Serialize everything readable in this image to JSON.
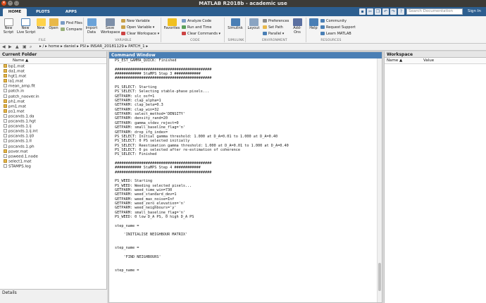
{
  "window": {
    "title": "MATLAB R2018b - academic use"
  },
  "tabs": [
    "HOME",
    "PLOTS",
    "APPS"
  ],
  "search": {
    "placeholder": "Search Documentation"
  },
  "signin": "Sign In",
  "ribbon": {
    "file": {
      "new_script": "New\nScript",
      "new_live_script": "New\nLive Script",
      "new": "New",
      "open": "Open",
      "find_files": "Find Files",
      "compare": "Compare",
      "label": "FILE"
    },
    "variable": {
      "import_data": "Import\nData",
      "save_workspace": "Save\nWorkspace",
      "new_variable": "New Variable",
      "open_variable": "Open Variable",
      "clear_workspace": "Clear Workspace",
      "label": "VARIABLE"
    },
    "code": {
      "favorites": "Favorites",
      "analyze_code": "Analyze Code",
      "run_and_time": "Run and Time",
      "clear_commands": "Clear Commands",
      "label": "CODE"
    },
    "simulink": {
      "simulink": "Simulink",
      "label": "SIMULINK"
    },
    "environment": {
      "layout": "Layout",
      "preferences": "Preferences",
      "set_path": "Set Path",
      "parallel": "Parallel",
      "addons": "Add-Ons",
      "label": "ENVIRONMENT"
    },
    "resources": {
      "help": "Help",
      "community": "Community",
      "request_support": "Request Support",
      "learn_matlab": "Learn MATLAB",
      "label": "RESOURCES"
    }
  },
  "path": {
    "crumbs": "▸  /  ▸  home  ▸  daniel  ▸  PSI  ▸  INSAR_20181129  ▸  PATCH_1  ▸"
  },
  "current_folder": {
    "title": "Current Folder",
    "column": "Name ▲",
    "files": [
      {
        "name": "bp1.mat",
        "type": "mat"
      },
      {
        "name": "da1.mat",
        "type": "mat"
      },
      {
        "name": "hgt1.mat",
        "type": "mat"
      },
      {
        "name": "la1.mat",
        "type": "mat"
      },
      {
        "name": "mean_amp.flt",
        "type": "txt"
      },
      {
        "name": "patch.in",
        "type": "txt"
      },
      {
        "name": "patch_noover.in",
        "type": "txt"
      },
      {
        "name": "ph1.mat",
        "type": "mat"
      },
      {
        "name": "pm1.mat",
        "type": "mat"
      },
      {
        "name": "ps1.mat",
        "type": "mat"
      },
      {
        "name": "pscands.1.da",
        "type": "txt"
      },
      {
        "name": "pscands.1.hgt",
        "type": "txt"
      },
      {
        "name": "pscands.1.ij",
        "type": "txt"
      },
      {
        "name": "pscands.1.ij.int",
        "type": "txt"
      },
      {
        "name": "pscands.1.ij0",
        "type": "txt"
      },
      {
        "name": "pscands.1.II",
        "type": "txt"
      },
      {
        "name": "pscands.1.ph",
        "type": "txt"
      },
      {
        "name": "psver.mat",
        "type": "mat"
      },
      {
        "name": "psweed.1.node",
        "type": "txt"
      },
      {
        "name": "select1.mat",
        "type": "mat"
      },
      {
        "name": "STAMPS.log",
        "type": "txt"
      }
    ],
    "details": "Details"
  },
  "command_window": {
    "title": "Command Window",
    "lines": [
      "PS_EST_GAMMA_QUICK: Finished",
      "",
      "############################################",
      "############ StaMPS Step 3 ############",
      "############################################",
      "",
      "PS_SELECT: Starting",
      "PS_SELECT: Selecting stable-phase pixels...",
      "GETPARM: slc_osf=1",
      "GETPARM: clap_alpha=1",
      "GETPARM: clap_beta=0.3",
      "GETPARM: clap_win=32",
      "GETPARM: select_method='DENSITY'",
      "GETPARM: density_rand=20",
      "GETPARM: gamma_stdev_reject=0",
      "GETPARM: small_baseline_flag='n'",
      "GETPARM: drop_ifg_index=",
      "PS_SELECT: Initial gamma threshold: 1.000 at D_A=0.01 to 1.000 at D_A=0.40",
      "PS_SELECT: 0 PS selected initially",
      "PS_SELECT: Reestimation gamma threshold: 1.000 at D_A=0.01 to 1.000 at D_A=0.40",
      "PS_SELECT: 0 ps selected after re-estimation of coherence",
      "PS_SELECT: Finished",
      "",
      "############################################",
      "############ StaMPS Step 4 ############",
      "############################################",
      "",
      "PS_WEED: Starting",
      "PS_WEED: Weeding selected pixels...",
      "GETPARM: weed_time_win=730",
      "GETPARM: weed_standard_dev=1",
      "GETPARM: weed_max_noise=Inf",
      "GETPARM: weed_zero_elevation='n'",
      "GETPARM: weed_neighbours='y'",
      "GETPARM: small_baseline_flag='n'",
      "PS_WEED: 0 low D_A PS, 0 high D_A PS",
      "",
      "step_name =",
      "",
      "    'INITIALISE NEIGHBOUR MATRIX'",
      "",
      "",
      "step_name =",
      "",
      "    'FIND NEIGHBOURS'",
      "",
      "",
      "step_name ="
    ]
  },
  "workspace": {
    "title": "Workspace",
    "col_name": "Name ▲",
    "col_value": "Value"
  }
}
